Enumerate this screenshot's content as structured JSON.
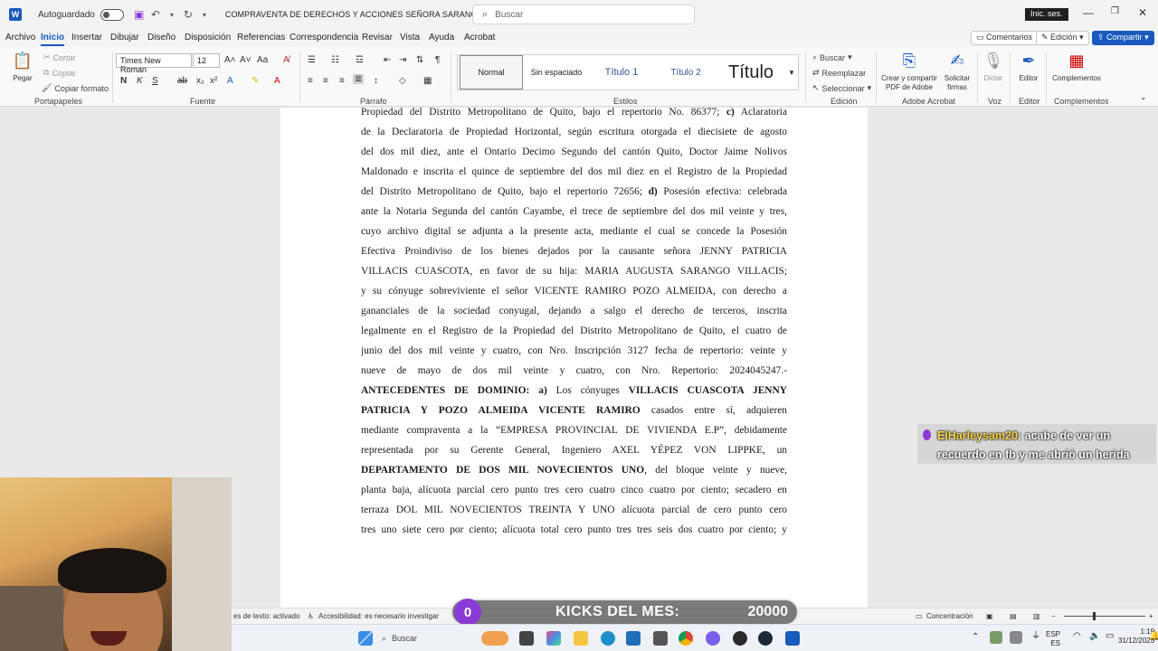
{
  "titlebar": {
    "autosave_label": "Autoguardado",
    "document_title": "COMPRAVENTA DE DERECHOS Y ACCIONES SEÑORA SARANGO VILLACIS",
    "search_placeholder": "Buscar",
    "signin_label": "Inic. ses."
  },
  "menu": {
    "tabs": [
      "Archivo",
      "Inicio",
      "Insertar",
      "Dibujar",
      "Diseño",
      "Disposición",
      "Referencias",
      "Correspondencia",
      "Revisar",
      "Vista",
      "Ayuda",
      "Acrobat"
    ],
    "active_tab": "Inicio",
    "comments_label": "Comentarios",
    "editing_label": "Edición",
    "share_label": "Compartir"
  },
  "ribbon": {
    "clipboard": {
      "paste": "Pegar",
      "cut": "Cortar",
      "copy": "Copiar",
      "format_painter": "Copiar formato",
      "group": "Portapapeles"
    },
    "font": {
      "name": "Times New Roman",
      "size": "12",
      "group": "Fuente"
    },
    "paragraph": {
      "group": "Párrafo"
    },
    "styles": {
      "items": [
        "Normal",
        "Sin espaciado",
        "Título 1",
        "Título 2",
        "Título"
      ],
      "selected": "Normal",
      "group": "Estilos"
    },
    "editing": {
      "find": "Buscar",
      "replace": "Reemplazar",
      "select": "Seleccionar",
      "group": "Edición"
    },
    "adobe": {
      "create_pdf": "Crear y compartir PDF de Adobe",
      "request_signatures": "Solicitar firmas",
      "group": "Adobe Acrobat"
    },
    "voice": {
      "dictate": "Dictar",
      "group": "Voz"
    },
    "editor": {
      "label": "Editor",
      "group": "Editor"
    },
    "addins": {
      "label": "Complementos",
      "group": "Complementos"
    }
  },
  "document": {
    "lines": [
      "Propiedad del Distrito Metropolitano de Quito, bajo el repertorio No. 86377; c) Aclaratoria",
      "de la Declaratoria de Propiedad Horizontal, según escritura otorgada el diecisiete de agosto",
      "del dos mil diez, ante el Ontario Decimo Segundo del cantón Quito, Doctor Jaime Nolivos",
      "Maldonado e inscrita el quince de septiembre del dos mil diez en el Registro de la Propiedad",
      "del Distrito Metropolitano de Quito, bajo el repertorio 72656; d) Posesión efectiva: celebrada",
      "ante la Notaria Segunda del cantón Cayambe, el trece de septiembre del dos mil veinte y tres,",
      "cuyo archivo digital se adjunta a la presente acta, mediante el cual se concede la Posesión",
      "Efectiva Proindiviso de los bienes dejados por la causante señora JENNY PATRICIA",
      "VILLACIS CUASCOTA, en favor de su hija: MARIA AUGUSTA SARANGO VILLACIS;",
      "y su cónyuge sobreviviente el señor VICENTE RAMIRO POZO ALMEIDA, con derecho a",
      "gananciales de la sociedad conyugal, dejando a salgo el derecho de terceros, inscrita",
      "legalmente en el Registro de la Propiedad del Distrito Metropolitano de Quito, el cuatro de",
      "junio del dos mil veinte y cuatro, con Nro. Inscripción 3127 fecha de repertorio: veinte y",
      "nueve de mayo de dos mil veinte y cuatro, con Nro. Repertorio: 2024045247.-",
      "ANTECEDENTES DE DOMINIO: a) Los cónyuges VILLACIS CUASCOTA JENNY",
      "PATRICIA Y POZO ALMEIDA VICENTE RAMIRO casados entre sí, adquieren",
      "mediante compraventa a la “EMPRESA PROVINCIAL DE VIVIENDA E.P”, debidamente",
      "representada por su Gerente General, Ingeniero AXEL YÉPEZ VON LIPPKE, un",
      "DEPARTAMENTO DE DOS MIL NOVECIENTOS UNO, del bloque veinte y nueve,",
      "planta baja, alícuota parcial cero punto tres cero cuatro cinco cuatro por ciento; secadero en",
      "terraza DOL MIL NOVECIENTOS TREINTA Y UNO alícuota parcial de cero punto cero",
      "tres uno siete cero por ciento; alícuota total cero punto tres tres seis dos cuatro por ciento; y"
    ]
  },
  "statusbar": {
    "text_prediction": "es de texto: activado",
    "accessibility": "Accesibilidad: es necesario investigar",
    "focus": "Concentración"
  },
  "overlay": {
    "chat_user": "ElHarleysam20",
    "chat_message": ": acabe de ver un recuerdo en fb y me abrió un herida",
    "kicks_count": "0",
    "kicks_label": "KICKS DEL MES:",
    "kicks_goal": "20000"
  },
  "taskbar": {
    "search_label": "Buscar",
    "lang": "ESP",
    "region": "ES",
    "time": "1:19",
    "date": "31/12/2025"
  }
}
